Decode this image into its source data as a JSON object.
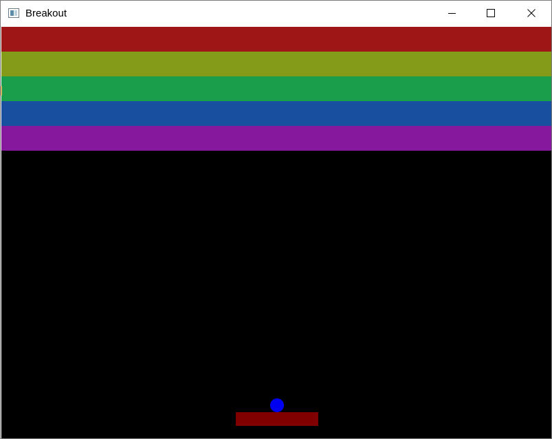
{
  "window": {
    "title": "Breakout",
    "icon": "app-window-icon",
    "controls": {
      "minimize_icon": "minimize-icon",
      "maximize_icon": "maximize-icon",
      "close_icon": "close-icon"
    }
  },
  "game": {
    "background": "#000000",
    "brick_rows": [
      {
        "color": "#9e1616"
      },
      {
        "color": "#849b19"
      },
      {
        "color": "#1a9e4b"
      },
      {
        "color": "#184f9e"
      },
      {
        "color": "#86189e"
      }
    ],
    "ball": {
      "color": "#0000f0"
    },
    "paddle": {
      "color": "#800000"
    }
  }
}
